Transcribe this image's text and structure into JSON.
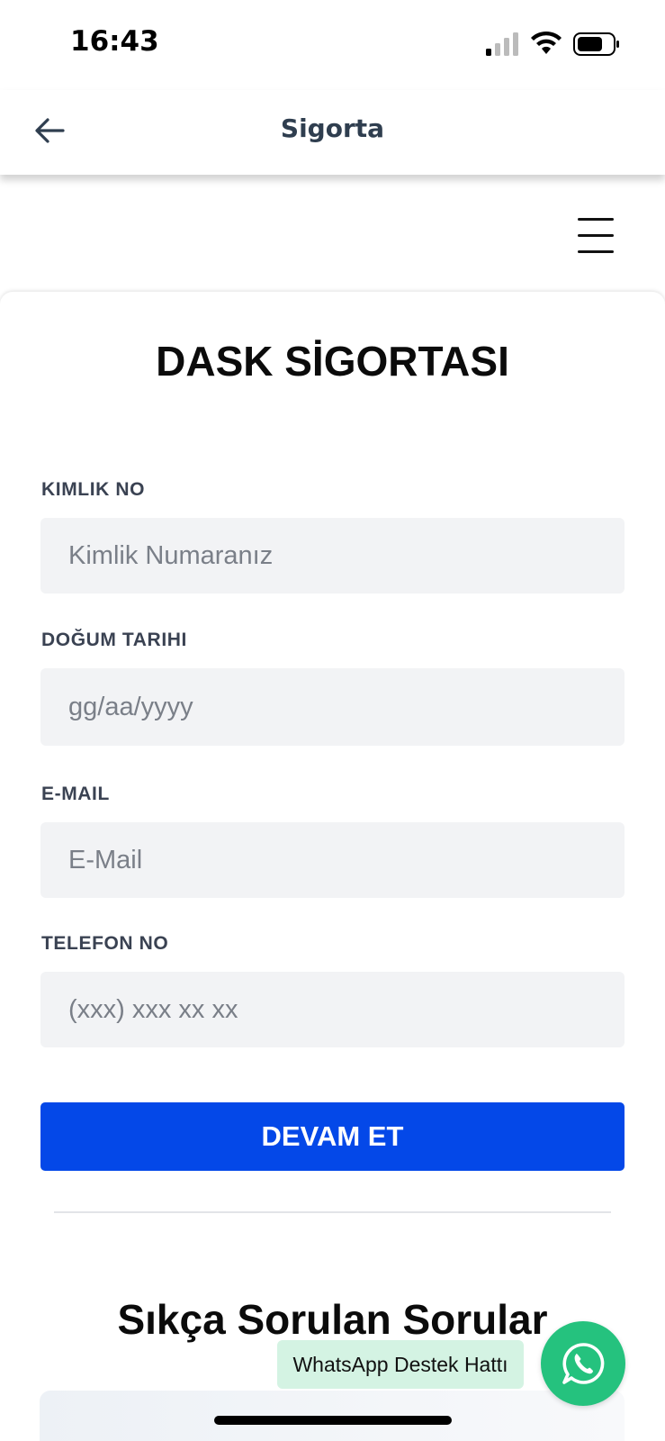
{
  "status_bar": {
    "time": "16:43",
    "icons": [
      "signal-icon",
      "wifi-icon",
      "battery-icon"
    ]
  },
  "header": {
    "title": "Sigorta",
    "back_icon": "arrow-left-icon"
  },
  "nav": {
    "menu_icon": "hamburger-menu-icon"
  },
  "form": {
    "title": "DASK SİGORTASI",
    "fields": [
      {
        "label": "KIMLIK NO",
        "placeholder": "Kimlik Numaranız",
        "value": ""
      },
      {
        "label": "DOĞUM TARIHI",
        "placeholder": "gg/aa/yyyy",
        "value": ""
      },
      {
        "label": "E-MAIL",
        "placeholder": "E-Mail",
        "value": ""
      },
      {
        "label": "TELEFON NO",
        "placeholder": "(xxx) xxx xx xx",
        "value": ""
      }
    ],
    "submit_label": "DEVAM ET"
  },
  "faq": {
    "title": "Sıkça Sorulan Sorular"
  },
  "whatsapp": {
    "label": "WhatsApp Destek Hattı",
    "icon": "whatsapp-icon"
  },
  "colors": {
    "primary": "#0448e8",
    "whatsapp": "#25c27e",
    "whatsapp_label_bg": "#d4f3e3",
    "input_bg": "#f2f3f5",
    "header_title": "#2f3e4f"
  }
}
